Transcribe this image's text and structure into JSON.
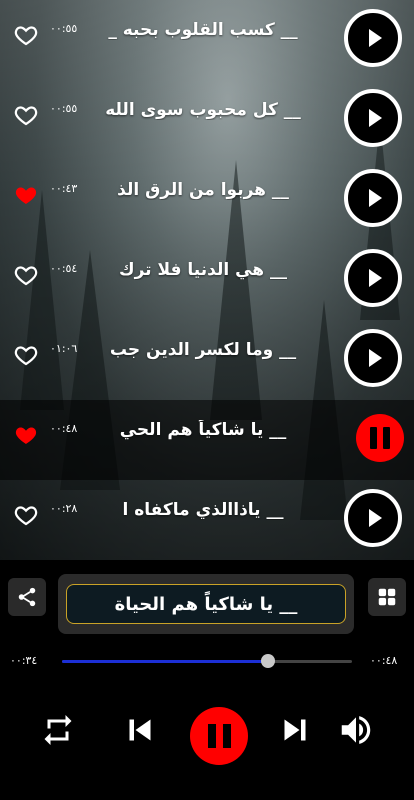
{
  "tracks": [
    {
      "title": "__ كسب القلوب بحبه _",
      "duration": "٠٠:٥٥",
      "liked": false,
      "playing": false
    },
    {
      "title": "__ كل محبوب سوى الله",
      "duration": "٠٠:٥٥",
      "liked": false,
      "playing": false
    },
    {
      "title": "__ هربوا من الرق الذ",
      "duration": "٠٠:٤٣",
      "liked": true,
      "playing": false
    },
    {
      "title": "__ هي الدنيا فلا ترك",
      "duration": "٠٠:٥٤",
      "liked": false,
      "playing": false
    },
    {
      "title": "__ وما لكسر الدين جب",
      "duration": "٠١:٠٦",
      "liked": false,
      "playing": false
    },
    {
      "title": "__ يا شاكياً هم الحي",
      "duration": "٠٠:٤٨",
      "liked": true,
      "playing": true
    },
    {
      "title": "__ ياذاالذي ماكفاه ا",
      "duration": "٠٠:٢٨",
      "liked": false,
      "playing": false
    }
  ],
  "player": {
    "now_playing": "__ يا شاكياً هم الحياة",
    "elapsed": "٠٠:٣٤",
    "total": "٠٠:٤٨",
    "progress": 0.71
  },
  "colors": {
    "accent_red": "#ff0000",
    "seek_fill": "#1c2fd6",
    "title_border": "#c9a227"
  },
  "icons": {
    "share": "share-icon",
    "grid": "grid-icon",
    "repeat": "repeat-icon",
    "previous": "skip-previous-icon",
    "pause": "pause-icon",
    "next": "skip-next-icon",
    "volume": "volume-icon"
  }
}
